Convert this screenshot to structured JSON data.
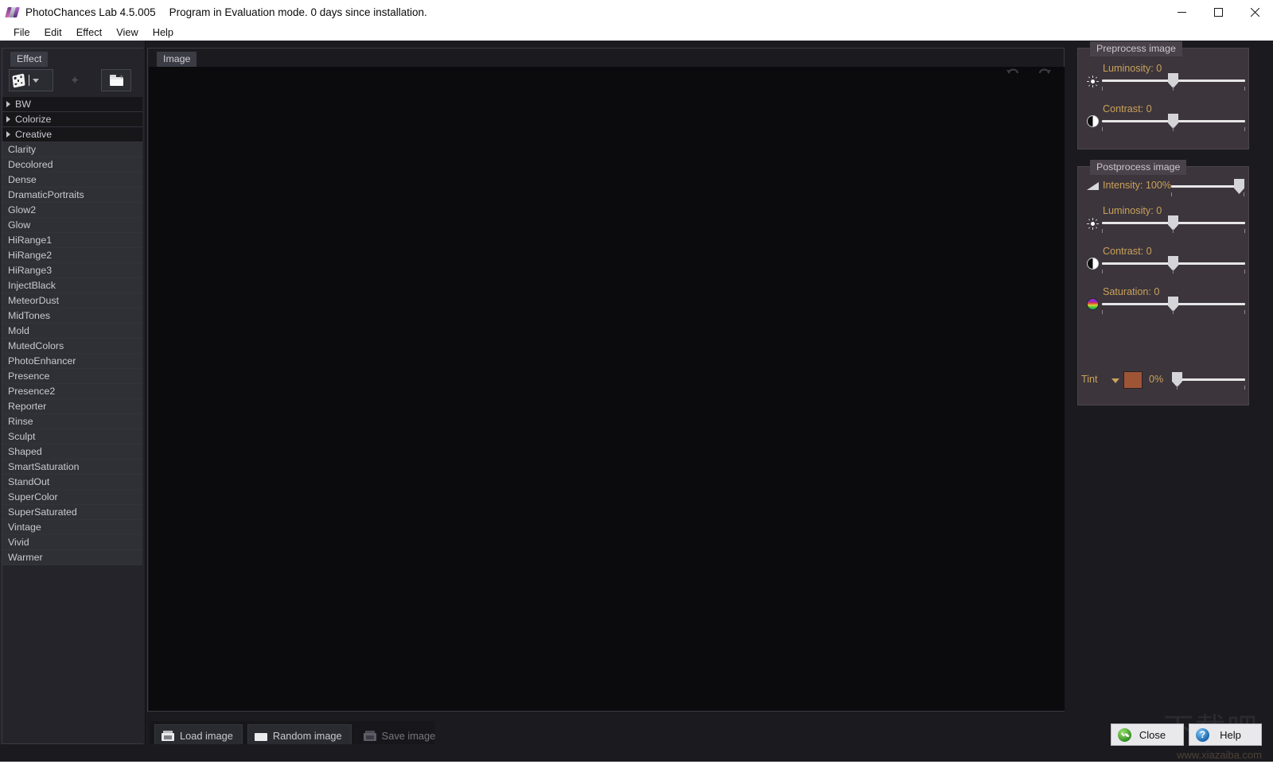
{
  "window": {
    "app_title": "PhotoChances Lab 4.5.005",
    "status_text": "Program in Evaluation mode. 0 days since installation.",
    "app_icon": "film-strip-icon",
    "minimize": "minimize-icon",
    "maximize": "maximize-icon",
    "close": "close-icon"
  },
  "menubar": {
    "items": [
      {
        "label": "File"
      },
      {
        "label": "Edit"
      },
      {
        "label": "Effect"
      },
      {
        "label": "View"
      },
      {
        "label": "Help"
      }
    ]
  },
  "sidebar": {
    "title": "Effect",
    "toolbar": {
      "random_icon": "dice-icon",
      "dropdown_icon": "chevron-down-icon",
      "favorite_icon": "star-icon",
      "open_icon": "folder-open-icon"
    },
    "items": [
      {
        "label": "BW",
        "type": "group"
      },
      {
        "label": "Colorize",
        "type": "group"
      },
      {
        "label": "Creative",
        "type": "group"
      },
      {
        "label": "Clarity",
        "type": "item"
      },
      {
        "label": "Decolored",
        "type": "item"
      },
      {
        "label": "Dense",
        "type": "item"
      },
      {
        "label": "DramaticPortraits",
        "type": "item"
      },
      {
        "label": "Glow2",
        "type": "item"
      },
      {
        "label": "Glow",
        "type": "item"
      },
      {
        "label": "HiRange1",
        "type": "item"
      },
      {
        "label": "HiRange2",
        "type": "item"
      },
      {
        "label": "HiRange3",
        "type": "item"
      },
      {
        "label": "InjectBlack",
        "type": "item"
      },
      {
        "label": "MeteorDust",
        "type": "item"
      },
      {
        "label": "MidTones",
        "type": "item"
      },
      {
        "label": "Mold",
        "type": "item"
      },
      {
        "label": "MutedColors",
        "type": "item"
      },
      {
        "label": "PhotoEnhancer",
        "type": "item"
      },
      {
        "label": "Presence",
        "type": "item"
      },
      {
        "label": "Presence2",
        "type": "item"
      },
      {
        "label": "Reporter",
        "type": "item"
      },
      {
        "label": "Rinse",
        "type": "item"
      },
      {
        "label": "Sculpt",
        "type": "item"
      },
      {
        "label": "Shaped",
        "type": "item"
      },
      {
        "label": "SmartSaturation",
        "type": "item"
      },
      {
        "label": "StandOut",
        "type": "item"
      },
      {
        "label": "SuperColor",
        "type": "item"
      },
      {
        "label": "SuperSaturated",
        "type": "item"
      },
      {
        "label": "Vintage",
        "type": "item"
      },
      {
        "label": "Vivid",
        "type": "item"
      },
      {
        "label": "Warmer",
        "type": "item"
      }
    ]
  },
  "center": {
    "title": "Image",
    "undo_icon": "undo-icon",
    "redo_icon": "redo-icon",
    "buttons": [
      {
        "label": "Load image",
        "icon": "load-image-icon",
        "enabled": true
      },
      {
        "label": "Random image",
        "icon": "random-image-icon",
        "enabled": true
      },
      {
        "label": "Save image",
        "icon": "save-image-icon",
        "enabled": false,
        "accel": "S"
      }
    ]
  },
  "preprocess": {
    "title": "Preprocess image",
    "sliders": [
      {
        "name": "Luminosity",
        "value": "0",
        "label": "Luminosity: 0",
        "icon": "brightness-icon",
        "pos_pct": 50
      },
      {
        "name": "Contrast",
        "value": "0",
        "label": "Contrast: 0",
        "icon": "contrast-icon",
        "pos_pct": 50
      }
    ]
  },
  "postprocess": {
    "title": "Postprocess image",
    "sliders": [
      {
        "name": "Intensity",
        "value": "100%",
        "label": "Intensity: 100%",
        "icon": "intensity-icon",
        "pos_pct": 100
      },
      {
        "name": "Luminosity",
        "value": "0",
        "label": "Luminosity: 0",
        "icon": "brightness-icon",
        "pos_pct": 50
      },
      {
        "name": "Contrast",
        "value": "0",
        "label": "Contrast: 0",
        "icon": "contrast-icon",
        "pos_pct": 50
      },
      {
        "name": "Saturation",
        "value": "0",
        "label": "Saturation: 0",
        "icon": "color-wheel-icon",
        "pos_pct": 50
      }
    ],
    "tint": {
      "label": "Tint",
      "percent": "0%",
      "color": "#9d5536",
      "dropdown_icon": "chevron-down-icon",
      "pos_pct": 0
    }
  },
  "footer": {
    "close_label": "Close",
    "close_icon": "green-check-icon",
    "help_label": "Help",
    "help_icon": "blue-question-icon",
    "watermark_cn": "下载吧",
    "watermark_url": "www.xiazaiba.com"
  },
  "colors": {
    "accent_label": "#c9a25a",
    "panel_bg": "#3c353c",
    "sidebar_bg": "#24242a",
    "canvas_bg": "#0b0b0d",
    "tint_swatch": "#9d5536"
  }
}
